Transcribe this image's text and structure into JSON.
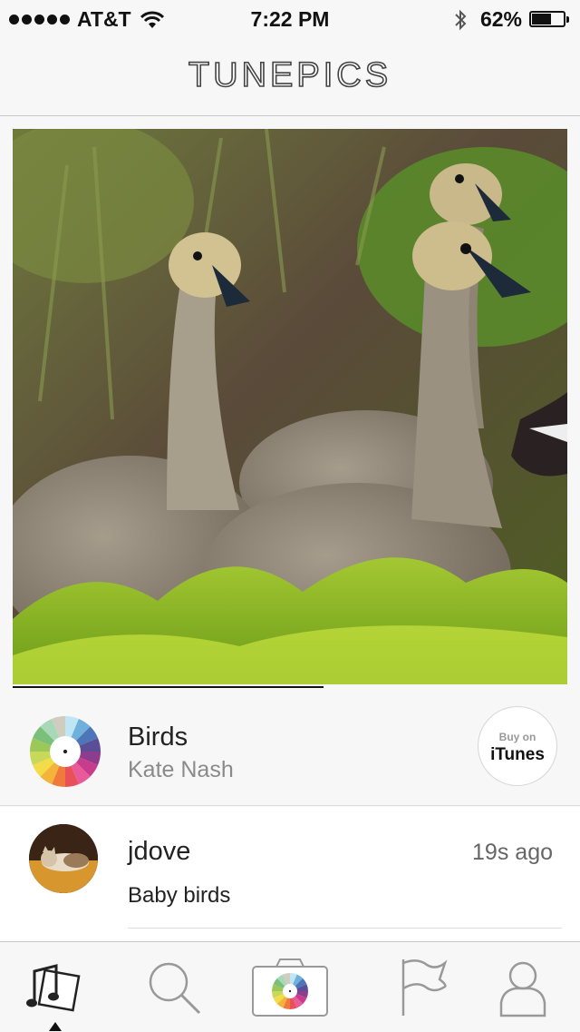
{
  "status_bar": {
    "carrier": "AT&T",
    "time": "7:22 PM",
    "battery_percent": "62%",
    "battery_level": 0.62,
    "icons": [
      "signal-dots",
      "wifi-icon",
      "bluetooth-icon",
      "battery-icon"
    ]
  },
  "header": {
    "title": "TUNEPICS"
  },
  "photo": {
    "subject_icon": "photo-goslings",
    "progress": 0.56
  },
  "song": {
    "title": "Birds",
    "artist": "Kate Nash",
    "buy_small": "Buy on",
    "buy_big": "iTunes"
  },
  "post": {
    "username": "jdove",
    "time_ago": "19s ago",
    "caption": "Baby birds"
  },
  "tab_bar": {
    "tabs": [
      "music-feed-icon",
      "search-icon",
      "camera-icon",
      "flag-icon",
      "profile-icon"
    ],
    "active": "music-feed-icon"
  },
  "colors": {
    "accent": "#111111",
    "background": "#f7f7f7"
  }
}
